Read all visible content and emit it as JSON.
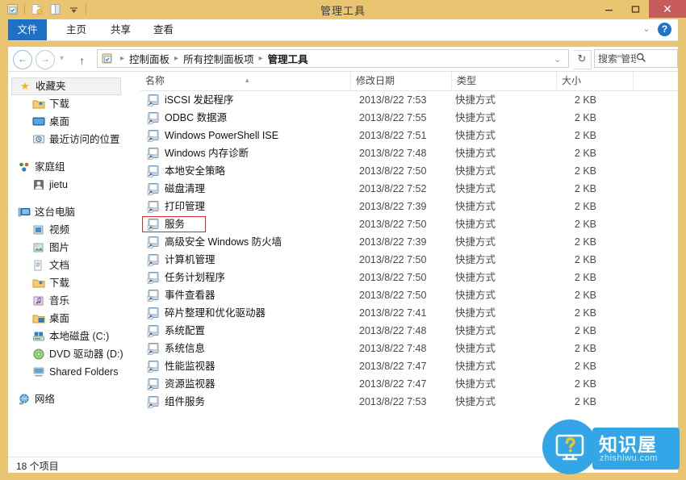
{
  "window": {
    "title": "管理工具",
    "minimize_label": "—",
    "maximize_label": "❐",
    "close_label": "✕",
    "quick_access": [
      "properties-icon",
      "new-folder-icon",
      "preview-pane-icon",
      "customize-dropdown-icon"
    ]
  },
  "ribbon": {
    "tabs": [
      {
        "label": "文件",
        "active": true
      },
      {
        "label": "主页",
        "active": false
      },
      {
        "label": "共享",
        "active": false
      },
      {
        "label": "查看",
        "active": false
      }
    ],
    "help_label": "?",
    "collapse_label": "⌄"
  },
  "addressbar": {
    "back_label": "←",
    "forward_label": "→",
    "recent_label": "▾",
    "up_label": "↑",
    "crumbs": [
      "控制面板",
      "所有控制面板项",
      "管理工具"
    ],
    "separator": "▸",
    "dropdown_label": "⌄",
    "refresh_label": "↻"
  },
  "search": {
    "value": "搜索\"管理...",
    "placeholder": "搜索\"管理工具\"",
    "icon": "search-icon"
  },
  "navpane": {
    "groups": [
      {
        "root": {
          "label": "收藏夹",
          "icon": "star-icon",
          "selected": true
        },
        "children": [
          {
            "label": "下载",
            "icon": "downloads-folder-icon"
          },
          {
            "label": "桌面",
            "icon": "desktop-icon"
          },
          {
            "label": "最近访问的位置",
            "icon": "recent-places-icon"
          }
        ]
      },
      {
        "root": {
          "label": "家庭组",
          "icon": "homegroup-icon",
          "selected": false
        },
        "children": [
          {
            "label": "jietu",
            "icon": "user-icon"
          }
        ]
      },
      {
        "root": {
          "label": "这台电脑",
          "icon": "this-pc-icon",
          "selected": false
        },
        "children": [
          {
            "label": "视频",
            "icon": "videos-folder-icon"
          },
          {
            "label": "图片",
            "icon": "pictures-folder-icon"
          },
          {
            "label": "文档",
            "icon": "documents-folder-icon"
          },
          {
            "label": "下载",
            "icon": "downloads-folder-icon"
          },
          {
            "label": "音乐",
            "icon": "music-folder-icon"
          },
          {
            "label": "桌面",
            "icon": "desktop-folder-icon"
          },
          {
            "label": "本地磁盘 (C:)",
            "icon": "local-disk-icon"
          },
          {
            "label": "DVD 驱动器 (D:)",
            "icon": "dvd-drive-icon"
          },
          {
            "label": "Shared Folders",
            "icon": "shared-folders-icon"
          }
        ]
      },
      {
        "root": {
          "label": "网络",
          "icon": "network-icon",
          "selected": false
        },
        "children": []
      }
    ]
  },
  "filelist": {
    "columns": [
      {
        "label": "名称",
        "sorted": "asc"
      },
      {
        "label": "修改日期",
        "sorted": ""
      },
      {
        "label": "类型",
        "sorted": ""
      },
      {
        "label": "大小",
        "sorted": ""
      }
    ],
    "sort_caret": "▴",
    "rows": [
      {
        "name": "iSCSI 发起程序",
        "date": "2013/8/22 7:53",
        "type": "快捷方式",
        "size": "2 KB",
        "highlighted": false
      },
      {
        "name": "ODBC 数据源",
        "date": "2013/8/22 7:55",
        "type": "快捷方式",
        "size": "2 KB",
        "highlighted": false
      },
      {
        "name": "Windows PowerShell ISE",
        "date": "2013/8/22 7:51",
        "type": "快捷方式",
        "size": "2 KB",
        "highlighted": false
      },
      {
        "name": "Windows 内存诊断",
        "date": "2013/8/22 7:48",
        "type": "快捷方式",
        "size": "2 KB",
        "highlighted": false
      },
      {
        "name": "本地安全策略",
        "date": "2013/8/22 7:50",
        "type": "快捷方式",
        "size": "2 KB",
        "highlighted": false
      },
      {
        "name": "磁盘清理",
        "date": "2013/8/22 7:52",
        "type": "快捷方式",
        "size": "2 KB",
        "highlighted": false
      },
      {
        "name": "打印管理",
        "date": "2013/8/22 7:39",
        "type": "快捷方式",
        "size": "2 KB",
        "highlighted": false
      },
      {
        "name": "服务",
        "date": "2013/8/22 7:50",
        "type": "快捷方式",
        "size": "2 KB",
        "highlighted": true
      },
      {
        "name": "高级安全 Windows 防火墙",
        "date": "2013/8/22 7:39",
        "type": "快捷方式",
        "size": "2 KB",
        "highlighted": false
      },
      {
        "name": "计算机管理",
        "date": "2013/8/22 7:50",
        "type": "快捷方式",
        "size": "2 KB",
        "highlighted": false
      },
      {
        "name": "任务计划程序",
        "date": "2013/8/22 7:50",
        "type": "快捷方式",
        "size": "2 KB",
        "highlighted": false
      },
      {
        "name": "事件查看器",
        "date": "2013/8/22 7:50",
        "type": "快捷方式",
        "size": "2 KB",
        "highlighted": false
      },
      {
        "name": "碎片整理和优化驱动器",
        "date": "2013/8/22 7:41",
        "type": "快捷方式",
        "size": "2 KB",
        "highlighted": false
      },
      {
        "name": "系统配置",
        "date": "2013/8/22 7:48",
        "type": "快捷方式",
        "size": "2 KB",
        "highlighted": false
      },
      {
        "name": "系统信息",
        "date": "2013/8/22 7:48",
        "type": "快捷方式",
        "size": "2 KB",
        "highlighted": false
      },
      {
        "name": "性能监视器",
        "date": "2013/8/22 7:47",
        "type": "快捷方式",
        "size": "2 KB",
        "highlighted": false
      },
      {
        "name": "资源监视器",
        "date": "2013/8/22 7:47",
        "type": "快捷方式",
        "size": "2 KB",
        "highlighted": false
      },
      {
        "name": "组件服务",
        "date": "2013/8/22 7:53",
        "type": "快捷方式",
        "size": "2 KB",
        "highlighted": false
      }
    ]
  },
  "statusbar": {
    "item_count_text": "18 个项目"
  },
  "watermark": {
    "brand_cn": "知识屋",
    "brand_en": "zhishiwu.com",
    "icon": "monitor-question-icon"
  },
  "colors": {
    "window_chrome": "#eac571",
    "file_tab": "#1f6fc4",
    "close_button": "#c75b5b",
    "highlight_box": "#d32c2c",
    "watermark_blue": "#33a6e8"
  }
}
